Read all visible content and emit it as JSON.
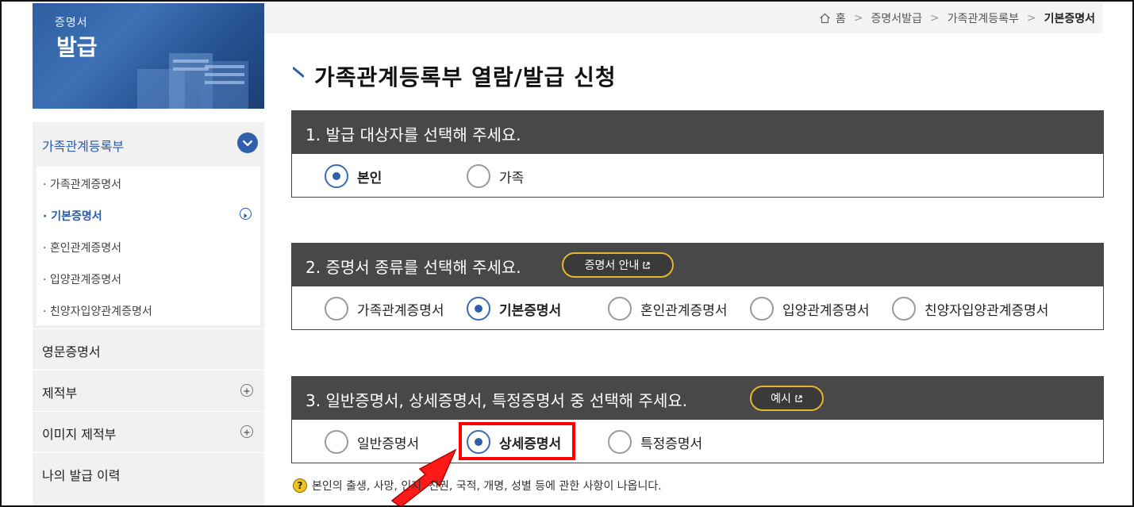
{
  "banner": {
    "title_small": "증명서",
    "title_big": "발급"
  },
  "sidebar": {
    "section_title": "가족관계등록부",
    "sub_items": [
      {
        "label": "가족관계증명서"
      },
      {
        "label": "기본증명서"
      },
      {
        "label": "혼인관계증명서"
      },
      {
        "label": "입양관계증명서"
      },
      {
        "label": "친양자입양관계증명서"
      }
    ],
    "items": [
      {
        "label": "영문증명서"
      },
      {
        "label": "제적부"
      },
      {
        "label": "이미지 제적부"
      },
      {
        "label": "나의 발급 이력"
      }
    ]
  },
  "breadcrumb": [
    "홈",
    "증명서발급",
    "가족관계등록부",
    "기본증명서"
  ],
  "page_title": "가족관계등록부 열람/발급 신청",
  "section1": {
    "title": "1. 발급 대상자를 선택해 주세요.",
    "options": [
      "본인",
      "가족"
    ],
    "selected": "본인"
  },
  "section2": {
    "title": "2. 증명서 종류를 선택해 주세요.",
    "info_button": "증명서 안내",
    "options": [
      "가족관계증명서",
      "기본증명서",
      "혼인관계증명서",
      "입양관계증명서",
      "친양자입양관계증명서"
    ],
    "selected": "기본증명서"
  },
  "section3": {
    "title": "3. 일반증명서, 상세증명서, 특정증명서 중 선택해 주세요.",
    "info_button": "예시",
    "options": [
      "일반증명서",
      "상세증명서",
      "특정증명서"
    ],
    "selected": "상세증명서"
  },
  "note": {
    "icon": "?",
    "text": "본인의 출생, 사망, 인지, 친권, 국적, 개명, 성별 등에 관한 사항이 나옵니다."
  },
  "colors": {
    "accent": "#2f5fa8",
    "section_header": "#484848",
    "highlight": "#ff0000",
    "pill_border": "#e2b731"
  }
}
